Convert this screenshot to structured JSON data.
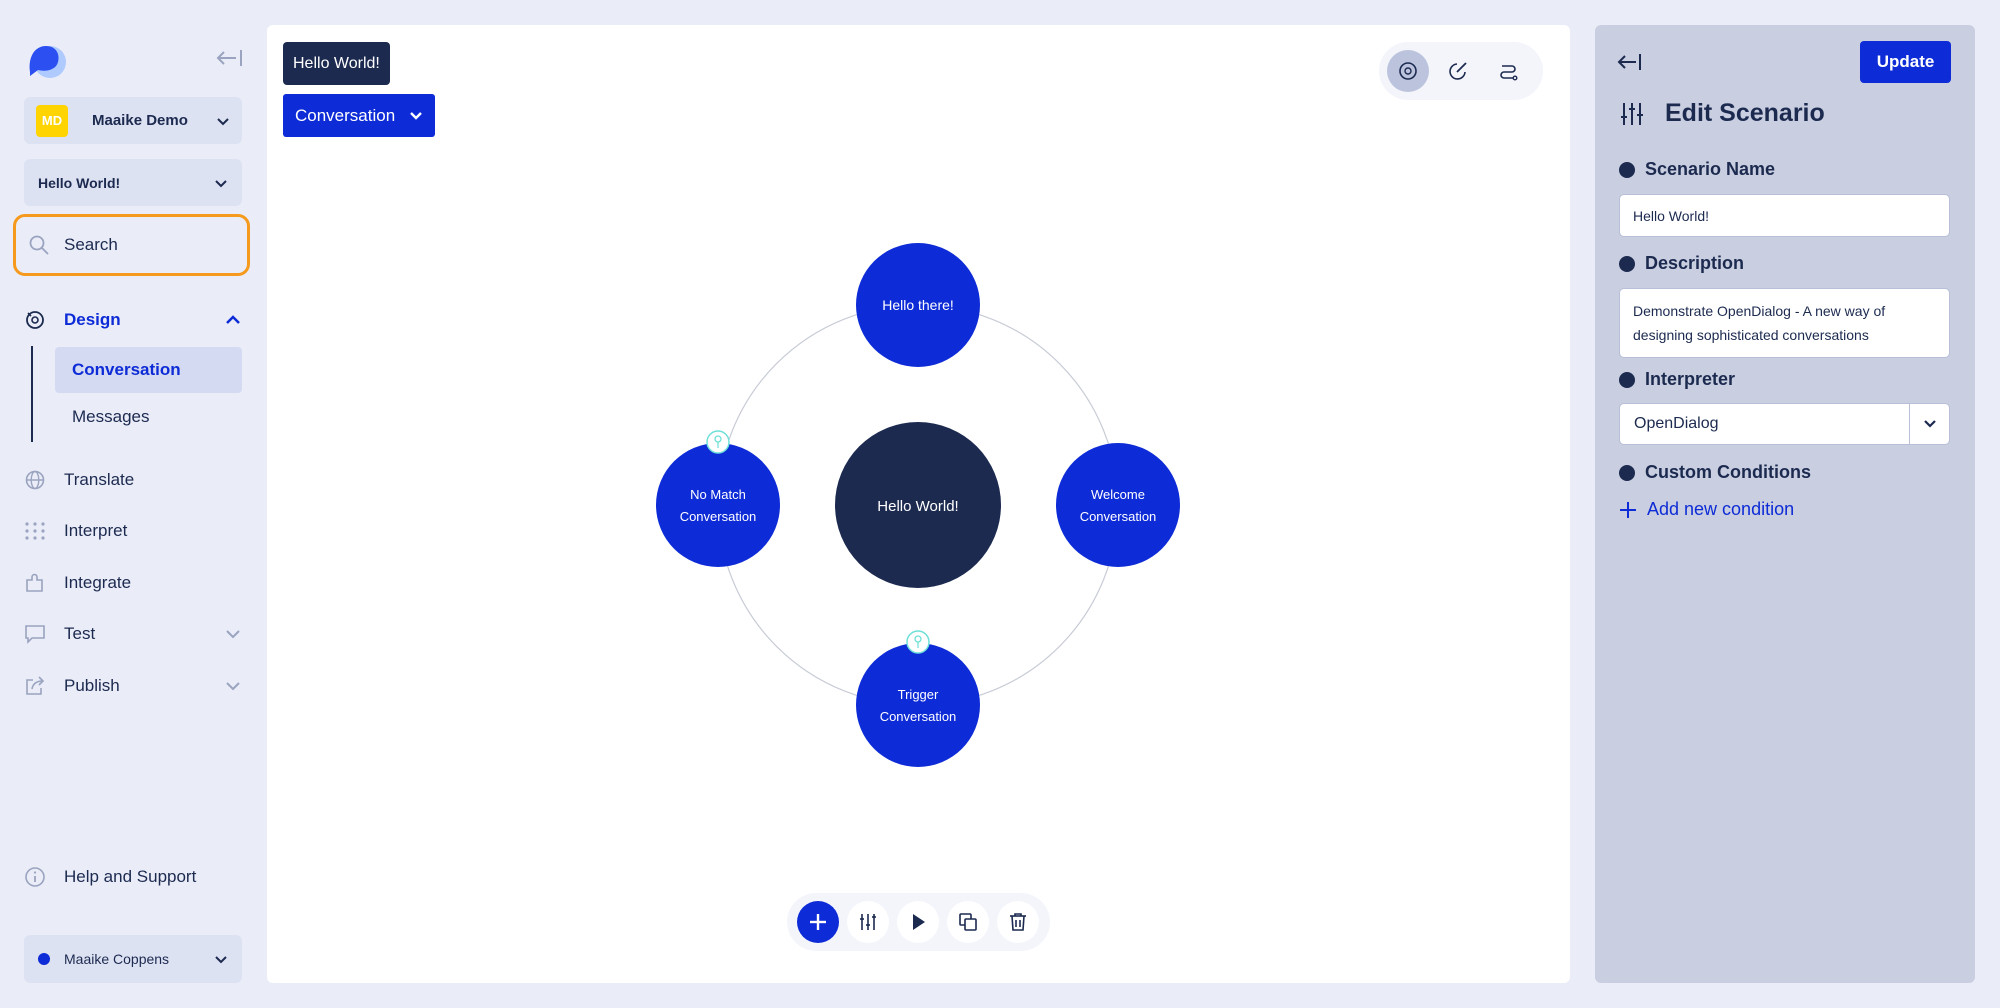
{
  "sidebar": {
    "workspace": {
      "initials": "MD",
      "name": "Maaike Demo"
    },
    "scenario_select": "Hello World!",
    "search": "Search",
    "nav": {
      "design": "Design",
      "conversation": "Conversation",
      "messages": "Messages",
      "translate": "Translate",
      "interpret": "Interpret",
      "integrate": "Integrate",
      "test": "Test",
      "publish": "Publish"
    },
    "help": "Help and Support",
    "user": "Maaike Coppens"
  },
  "canvas": {
    "breadcrumb_title": "Hello World!",
    "breadcrumb_select": "Conversation",
    "nodes": {
      "center": "Hello World!",
      "top": "Hello there!",
      "left": [
        "No Match",
        "Conversation"
      ],
      "right": [
        "Welcome",
        "Conversation"
      ],
      "bottom": [
        "Trigger",
        "Conversation"
      ]
    }
  },
  "panel": {
    "update_label": "Update",
    "title": "Edit Scenario",
    "scenario_name_label": "Scenario Name",
    "scenario_name_value": "Hello World!",
    "description_label": "Description",
    "description_value": "Demonstrate OpenDialog - A new way of designing sophisticated conversations",
    "interpreter_label": "Interpreter",
    "interpreter_value": "OpenDialog",
    "custom_conditions_label": "Custom Conditions",
    "add_condition_label": "Add new condition"
  },
  "colors": {
    "accent": "#0d2bd6",
    "navy": "#1c2a50",
    "search_highlight": "#f59a1c",
    "workspace_badge": "#ffd400"
  }
}
